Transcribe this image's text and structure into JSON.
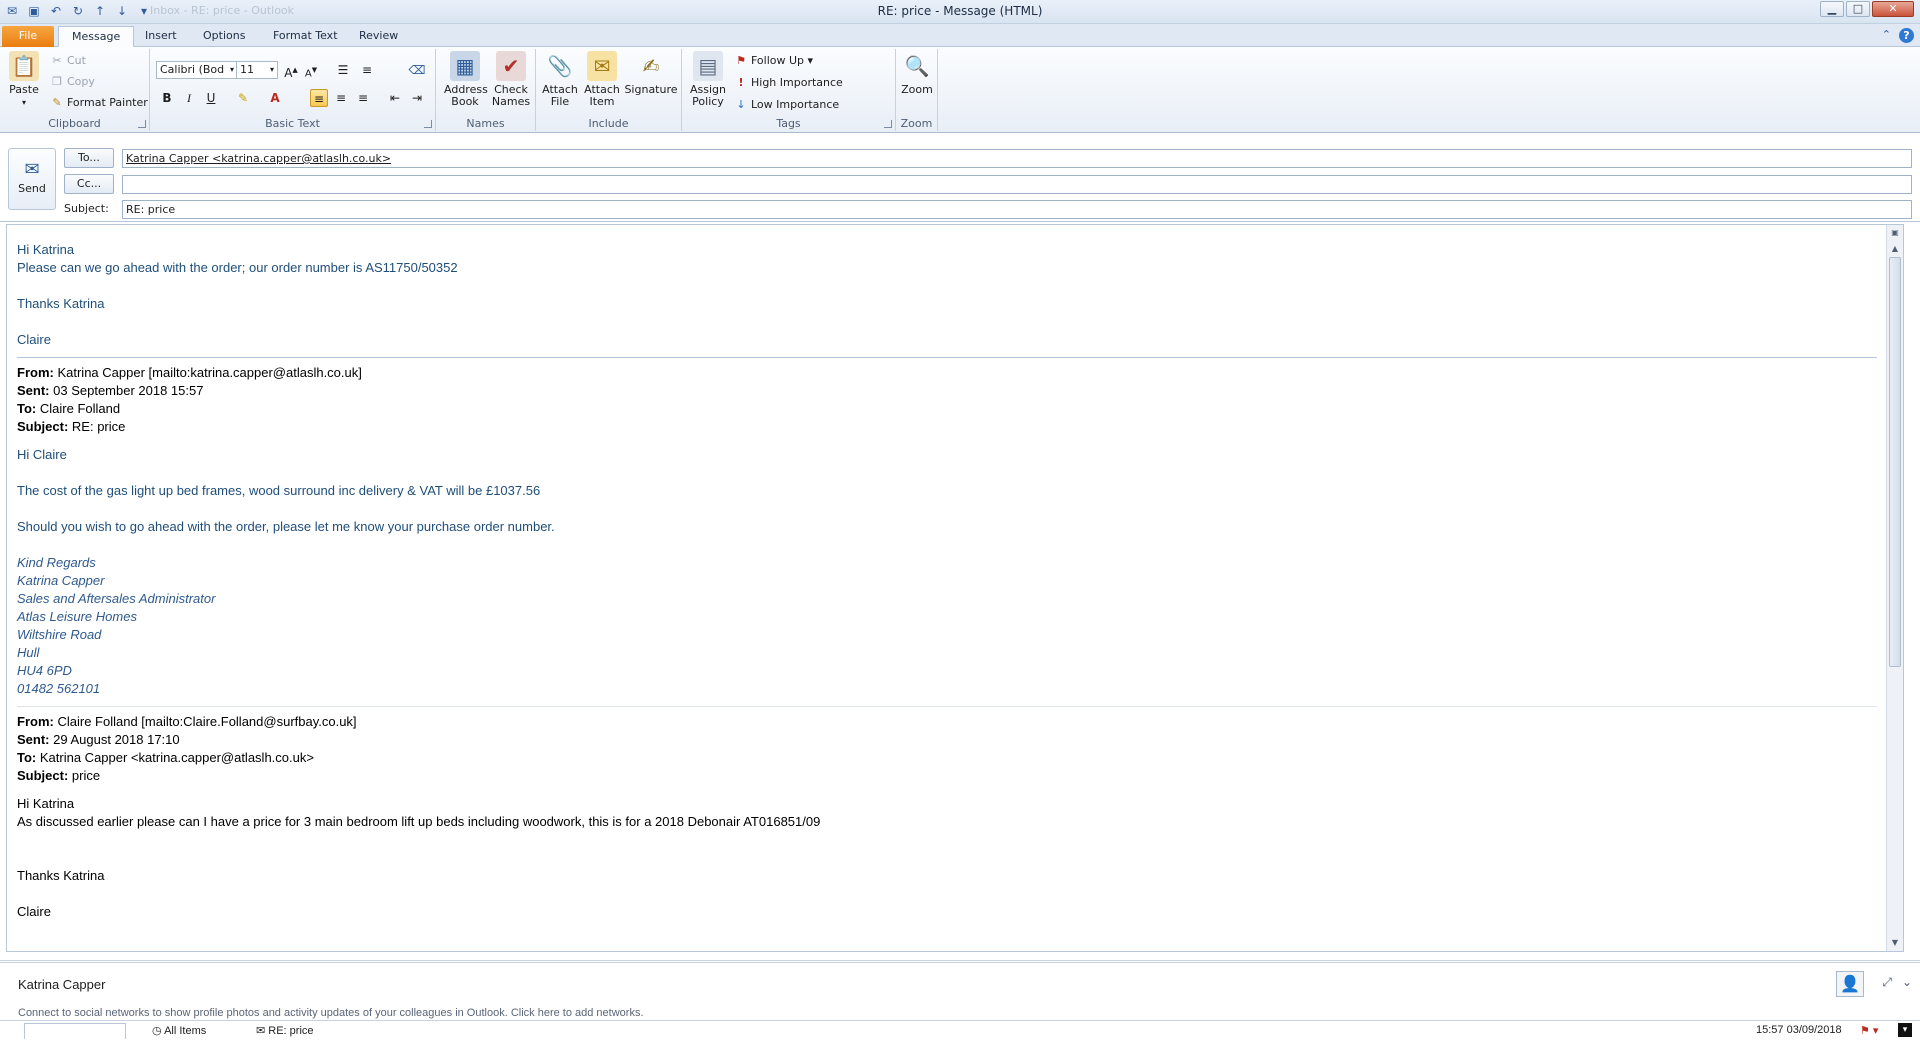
{
  "window": {
    "title": "RE: price  -  Message (HTML)",
    "faded_title": "Inbox - RE: price - Outlook",
    "buttons": {
      "minimize": "▁",
      "maximize": "□",
      "close": "✕"
    }
  },
  "tabs": [
    "File",
    "Message",
    "Insert",
    "Options",
    "Format Text",
    "Review"
  ],
  "ribbon": {
    "clipboard": {
      "paste": "Paste",
      "cut": "Cut",
      "copy": "Copy",
      "format_painter": "Format Painter",
      "label": "Clipboard"
    },
    "basic_text": {
      "font": "Calibri (Bod",
      "size": "11",
      "label": "Basic Text"
    },
    "names": {
      "address_book": "Address Book",
      "check_names": "Check Names",
      "label": "Names"
    },
    "include": {
      "attach_file": "Attach File",
      "attach_item": "Attach Item",
      "signature": "Signature",
      "label": "Include"
    },
    "tags": {
      "assign_policy": "Assign Policy",
      "follow_up": "Follow Up",
      "high_importance": "High Importance",
      "low_importance": "Low Importance",
      "label": "Tags"
    },
    "zoom": {
      "zoom": "Zoom",
      "label": "Zoom"
    }
  },
  "header": {
    "send": "Send",
    "to_button": "To...",
    "cc_button": "Cc...",
    "subject_label": "Subject:",
    "to_value": "Katrina Capper <katrina.capper@atlaslh.co.uk>",
    "cc_value": "",
    "subject_value": "RE: price"
  },
  "body": {
    "reply": {
      "greeting": "Hi Katrina",
      "line1": "Please can we go ahead with the order; our order number is AS11750/50352",
      "thanks": "Thanks Katrina",
      "signoff": "Claire"
    },
    "quoted1": {
      "from_label": "From:",
      "from": "Katrina Capper [mailto:katrina.capper@atlaslh.co.uk]",
      "sent_label": "Sent:",
      "sent": "03 September 2018 15:57",
      "to_label": "To:",
      "to": "Claire Folland",
      "subject_label": "Subject:",
      "subject": "RE: price",
      "greeting": "Hi Claire",
      "para1": "The cost of the gas light up bed frames, wood surround inc delivery & VAT will be £1037.56",
      "para2": "Should you wish to go ahead with the order, please let me know your purchase order number.",
      "signature": [
        "Kind Regards",
        "Katrina Capper",
        "Sales and Aftersales Administrator",
        "Atlas Leisure Homes",
        "Wiltshire Road",
        "Hull",
        "HU4 6PD",
        "01482 562101"
      ]
    },
    "quoted2": {
      "from_label": "From:",
      "from": "Claire Folland [mailto:Claire.Folland@surfbay.co.uk]",
      "sent_label": "Sent:",
      "sent": "29 August 2018 17:10",
      "to_label": "To:",
      "to": "Katrina Capper <katrina.capper@atlaslh.co.uk>",
      "subject_label": "Subject:",
      "subject": "price",
      "greeting": "Hi Katrina",
      "para1": "As discussed earlier please can I have a price for 3 main bedroom lift up beds including woodwork, this is for a 2018 Debonair AT016851/09",
      "thanks": "Thanks Katrina",
      "signoff": "Claire"
    }
  },
  "people_pane": {
    "name": "Katrina Capper",
    "hint": "Connect to social networks to show profile photos and activity updates of your colleagues in Outlook. Click here to add networks."
  },
  "statusbar": {
    "all_items": "All Items",
    "item": "RE: price",
    "timestamp": "15:57  03/09/2018"
  }
}
